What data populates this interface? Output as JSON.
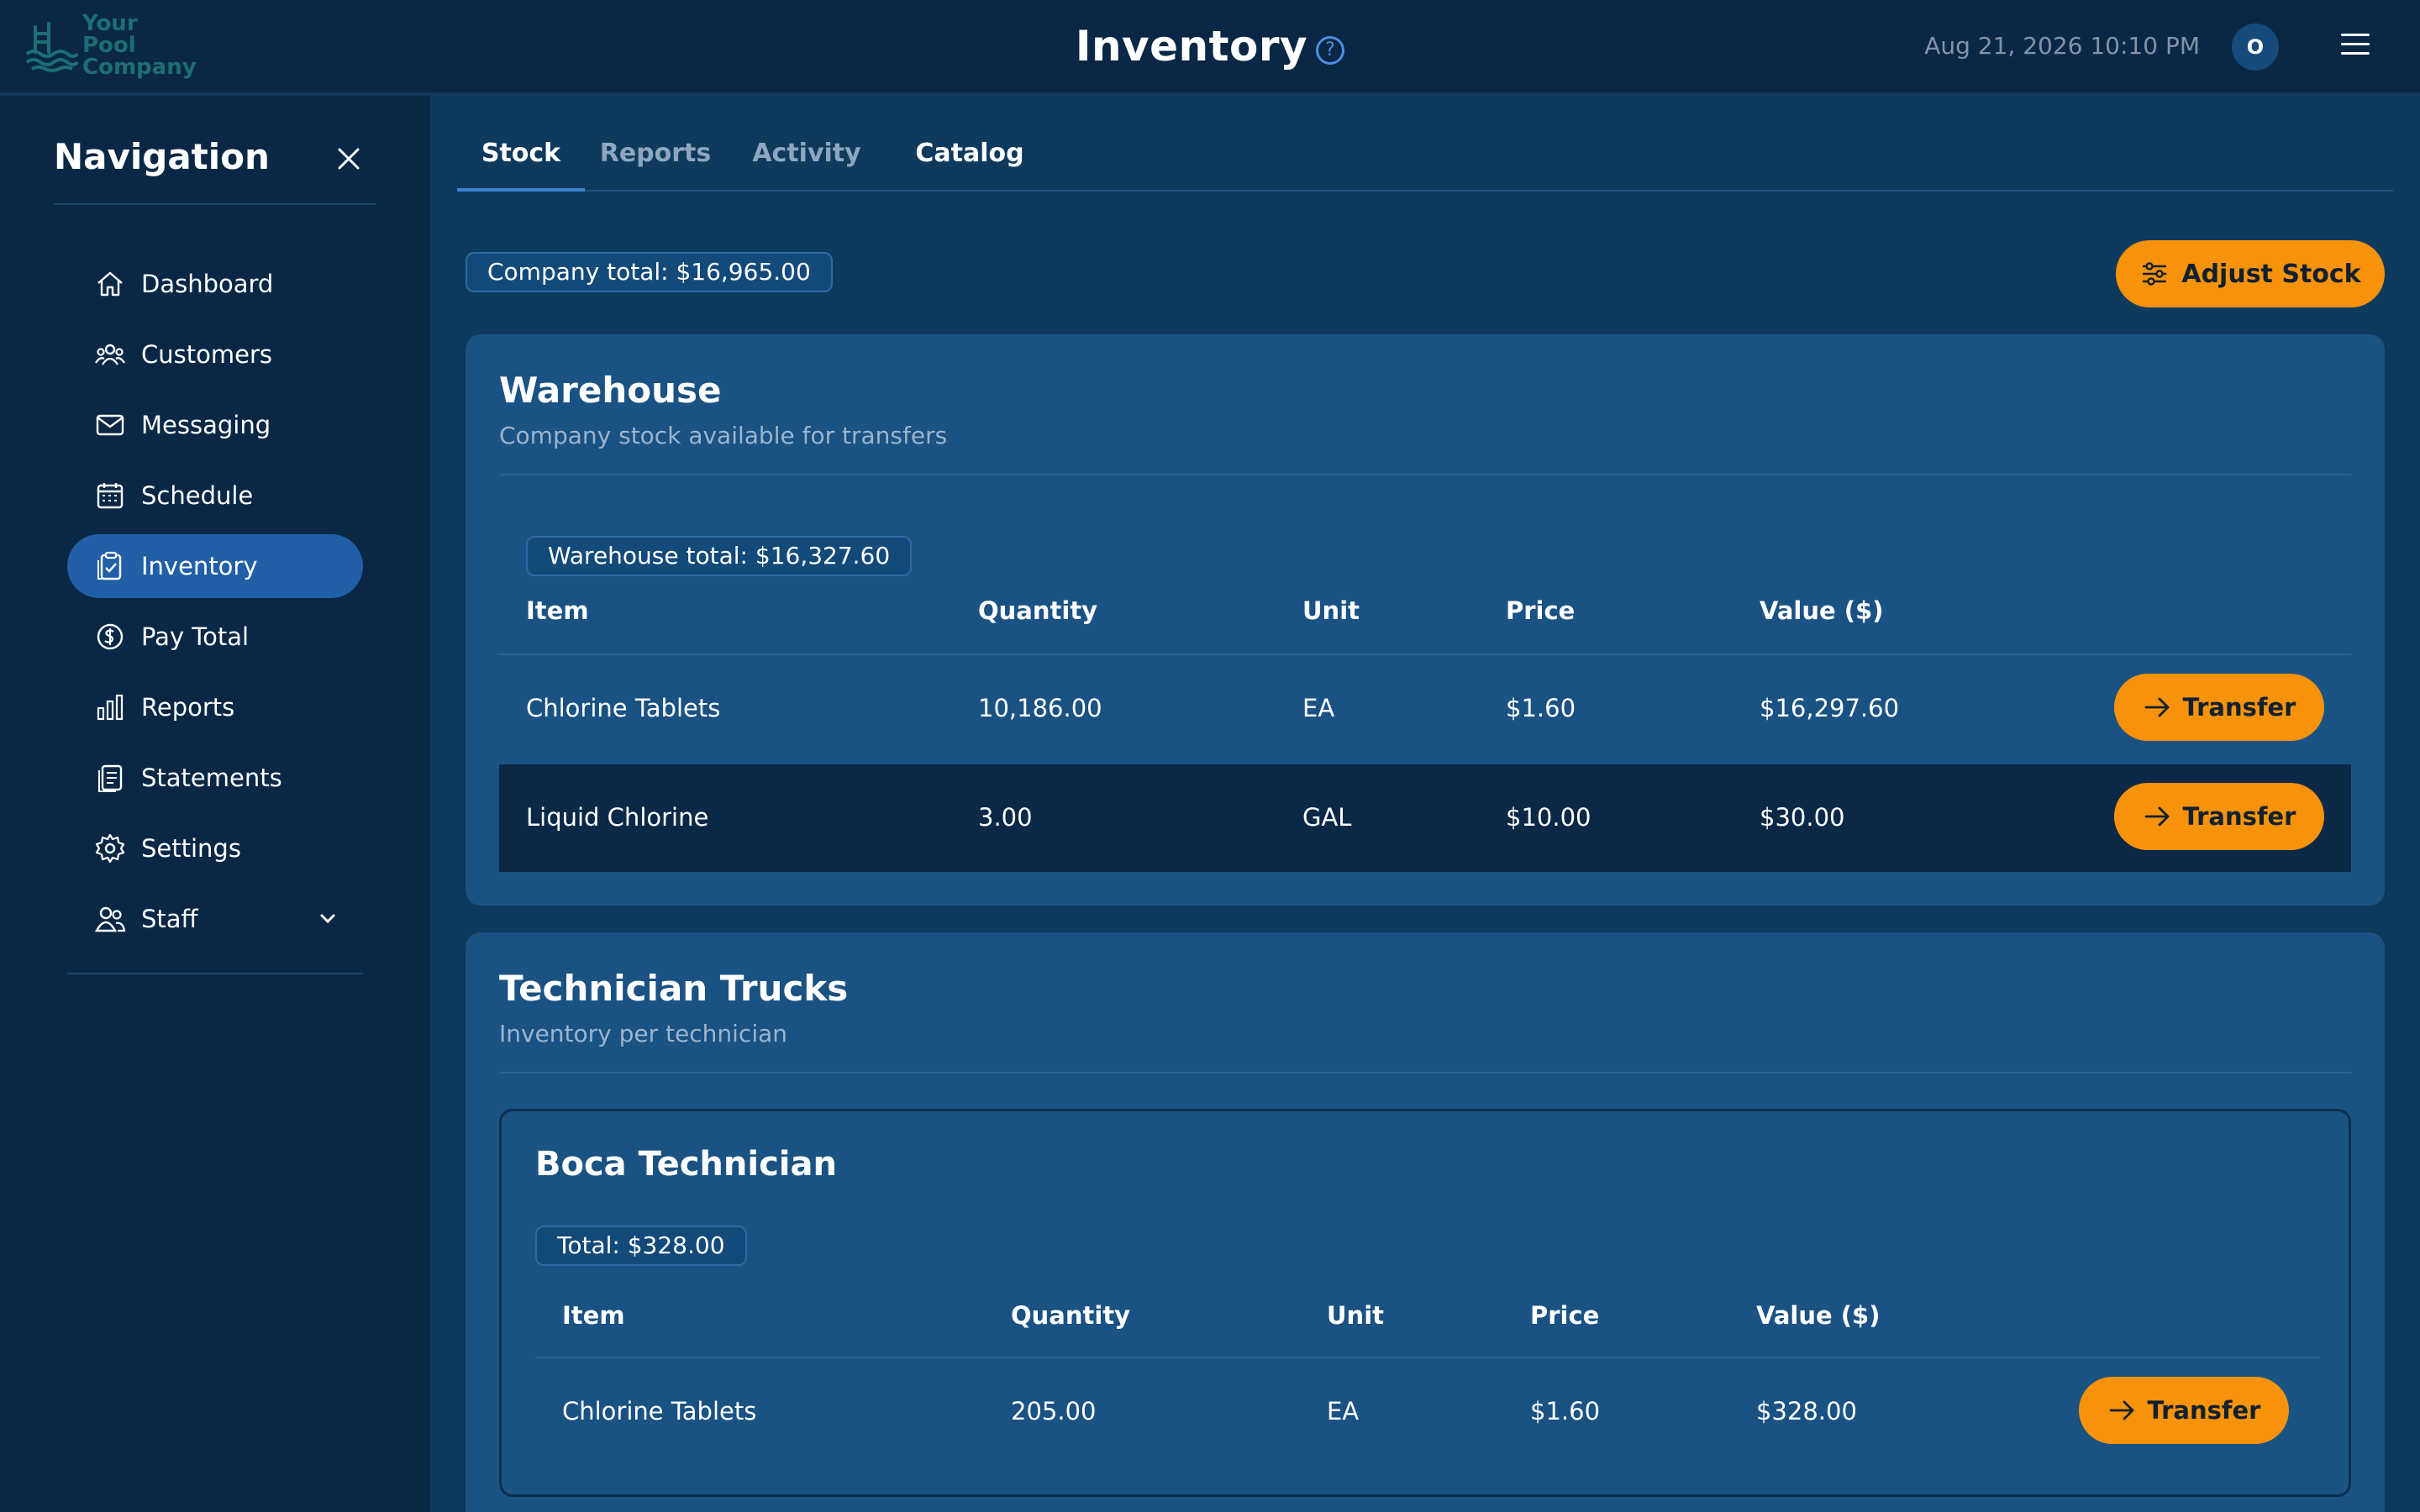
{
  "header": {
    "logo_line1": "Your Pool",
    "logo_line2": "Company",
    "title": "Inventory",
    "help_glyph": "?",
    "datetime": "Aug 21, 2026 10:10 PM",
    "avatar_initial": "O"
  },
  "sidebar": {
    "title": "Navigation",
    "items": [
      {
        "label": "Dashboard",
        "icon": "home-icon"
      },
      {
        "label": "Customers",
        "icon": "users-icon"
      },
      {
        "label": "Messaging",
        "icon": "mail-icon"
      },
      {
        "label": "Schedule",
        "icon": "calendar-icon"
      },
      {
        "label": "Inventory",
        "icon": "clipboard-check-icon",
        "active": true
      },
      {
        "label": "Pay Total",
        "icon": "dollar-circle-icon"
      },
      {
        "label": "Reports",
        "icon": "bar-chart-icon"
      },
      {
        "label": "Statements",
        "icon": "documents-icon"
      },
      {
        "label": "Settings",
        "icon": "gear-icon"
      },
      {
        "label": "Staff",
        "icon": "staff-icon",
        "expandable": true
      }
    ]
  },
  "tabs": [
    "Stock",
    "Reports",
    "Activity",
    "Catalog"
  ],
  "company_total": "Company total: $16,965.00",
  "adjust_stock_label": "Adjust Stock",
  "warehouse": {
    "title": "Warehouse",
    "subtitle": "Company stock available for transfers",
    "total": "Warehouse total: $16,327.60",
    "columns": [
      "Item",
      "Quantity",
      "Unit",
      "Price",
      "Value ($)"
    ],
    "rows": [
      {
        "item": "Chlorine Tablets",
        "quantity": "10,186.00",
        "unit": "EA",
        "price": "$1.60",
        "value": "$16,297.60",
        "action": "Transfer"
      },
      {
        "item": "Liquid Chlorine",
        "quantity": "3.00",
        "unit": "GAL",
        "price": "$10.00",
        "value": "$30.00",
        "action": "Transfer"
      }
    ]
  },
  "trucks": {
    "title": "Technician Trucks",
    "subtitle": "Inventory per technician",
    "technician": {
      "name": "Boca Technician",
      "total": "Total: $328.00",
      "columns": [
        "Item",
        "Quantity",
        "Unit",
        "Price",
        "Value ($)"
      ],
      "rows": [
        {
          "item": "Chlorine Tablets",
          "quantity": "205.00",
          "unit": "EA",
          "price": "$1.60",
          "value": "$328.00",
          "action": "Transfer"
        }
      ]
    }
  },
  "colors": {
    "background": "#0e3a5e",
    "topbar": "#0a2845",
    "card": "#1a5283",
    "accent_orange": "#f7930a",
    "active_nav": "#2160a6"
  }
}
